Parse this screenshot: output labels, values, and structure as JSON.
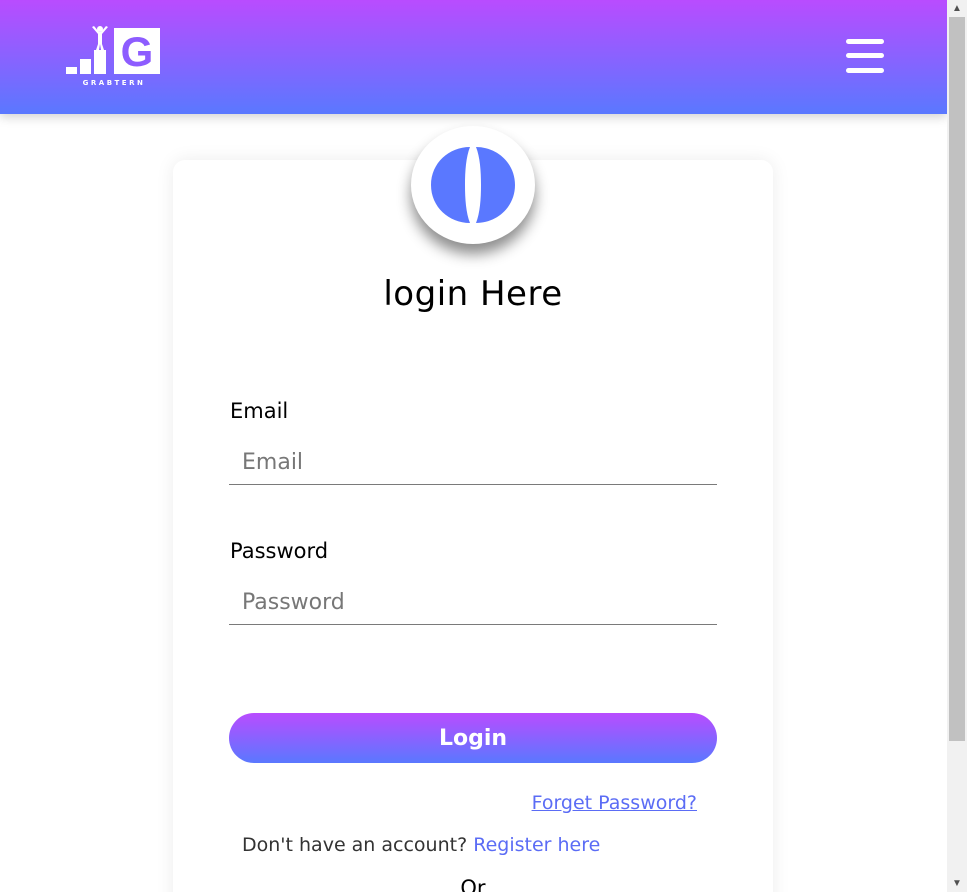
{
  "header": {
    "logo_text": "GRABTERN",
    "logo_letter": "G",
    "menu_icon": "hamburger-menu-icon",
    "gradient_top": "#b94cff",
    "gradient_bottom": "#5a78ff"
  },
  "login": {
    "title": "login Here",
    "avatar_icon": "split-circle-avatar-icon",
    "email_label": "Email",
    "email_placeholder": "Email",
    "email_value": "",
    "password_label": "Password",
    "password_placeholder": "Password",
    "password_value": "",
    "login_button": "Login",
    "forget_link": "Forget Password?",
    "no_account_text": "Don't have an account? ",
    "register_link": "Register here",
    "or_text": "Or"
  },
  "colors": {
    "accent": "#5b6cf5",
    "avatar": "#5a78ff"
  }
}
